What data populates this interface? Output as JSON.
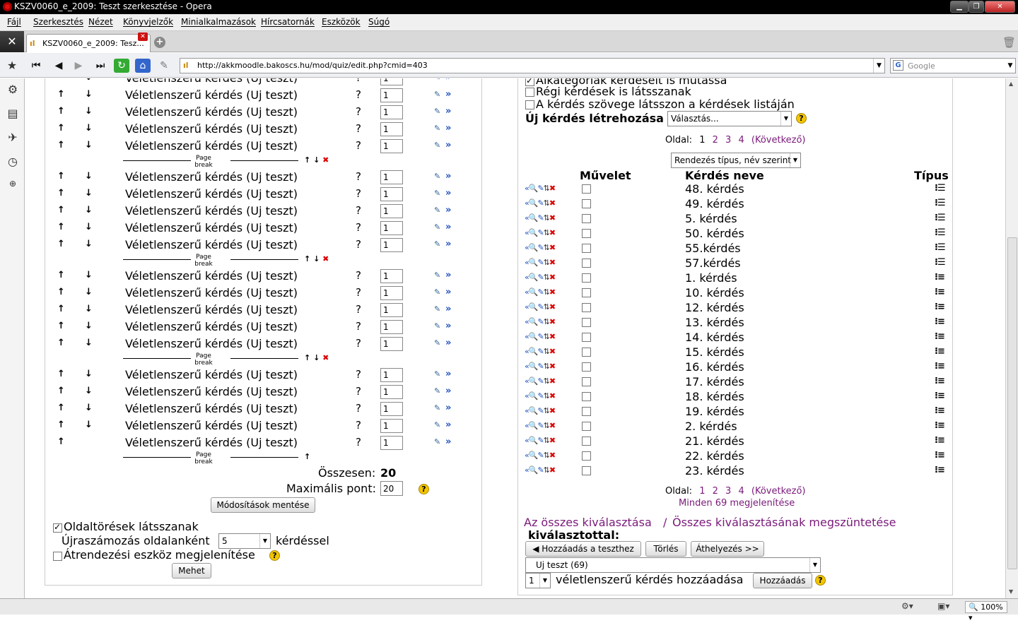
{
  "window": {
    "title": "KSZV0060_e_2009: Teszt szerkesztése - Opera"
  },
  "menu": [
    "Fájl",
    "Szerkesztés",
    "Nézet",
    "Könyvjelzők",
    "Minialkalmazások",
    "Hírcsatornák",
    "Eszközök",
    "Súgó"
  ],
  "tab": {
    "label": "KSZV0060_e_2009: Tesz..."
  },
  "address": {
    "url": "http://akkmoodle.bakoscs.hu/mod/quiz/edit.php?cmid=403"
  },
  "search": {
    "placeholder": "Google"
  },
  "zoom": "100%",
  "quiz": {
    "question_label": "Véletlenszerű kérdés (Uj teszt)",
    "help_mark": "?",
    "grade_value": "1",
    "page_break_label": "Page break",
    "total_label": "Összesen:",
    "total_value": "20",
    "max_label": "Maximális pont:",
    "max_value": "20",
    "save_button": "Módosítások mentése",
    "show_breaks_label": "Oldaltörések látsszanak",
    "renumber_label": "Újraszámozás oldalanként",
    "renumber_value": "5",
    "renumber_suffix": "kérdéssel",
    "reorder_label": "Átrendezési eszköz megjelenítése",
    "go_button": "Mehet"
  },
  "bank": {
    "opt_subcategories": "Alkategóriák kérdéseit is mutassa",
    "opt_old": "Régi kérdések is látsszanak",
    "opt_text": "A kérdés szövege látsszon a kérdések listáján",
    "new_question_label": "Új kérdés létrehozása",
    "new_question_select": "Választás...",
    "page_label": "Oldal:",
    "pages": [
      "1",
      "2",
      "3",
      "4"
    ],
    "next_label": "(Következő)",
    "sort_select": "Rendezés típus, név szerint",
    "col_action": "Művelet",
    "col_name": "Kérdés neve",
    "col_type": "Típus",
    "questions": [
      {
        "name": "48. kérdés",
        "type": "random"
      },
      {
        "name": "49. kérdés",
        "type": "random"
      },
      {
        "name": "5. kérdés",
        "type": "random"
      },
      {
        "name": "50. kérdés",
        "type": "random"
      },
      {
        "name": "55.kérdés",
        "type": "random"
      },
      {
        "name": "57.kérdés",
        "type": "random"
      },
      {
        "name": "1. kérdés",
        "type": "multichoice"
      },
      {
        "name": "10. kérdés",
        "type": "multichoice"
      },
      {
        "name": "12. kérdés",
        "type": "multichoice"
      },
      {
        "name": "13. kérdés",
        "type": "multichoice"
      },
      {
        "name": "14. kérdés",
        "type": "multichoice"
      },
      {
        "name": "15. kérdés",
        "type": "multichoice"
      },
      {
        "name": "16. kérdés",
        "type": "multichoice"
      },
      {
        "name": "17. kérdés",
        "type": "multichoice"
      },
      {
        "name": "18. kérdés",
        "type": "multichoice"
      },
      {
        "name": "19. kérdés",
        "type": "multichoice"
      },
      {
        "name": "2. kérdés",
        "type": "multichoice"
      },
      {
        "name": "21. kérdés",
        "type": "multichoice"
      },
      {
        "name": "22. kérdés",
        "type": "multichoice"
      },
      {
        "name": "23. kérdés",
        "type": "multichoice"
      }
    ],
    "show_all_label": "Minden 69 megjelenítése",
    "select_all": "Az összes kiválasztása",
    "separator": "/",
    "deselect_all": "Összes kiválasztásának megszüntetése",
    "with_selected": "kiválasztottal:",
    "add_to_quiz_button": "Hozzáadás a teszthez",
    "delete_button": "Törlés",
    "move_button": "Áthelyezés >>",
    "category_select": "Uj teszt (69)",
    "random_count_value": "1",
    "random_add_label": "véletlenszerű kérdés hozzáadása",
    "random_add_button": "Hozzáadás"
  }
}
